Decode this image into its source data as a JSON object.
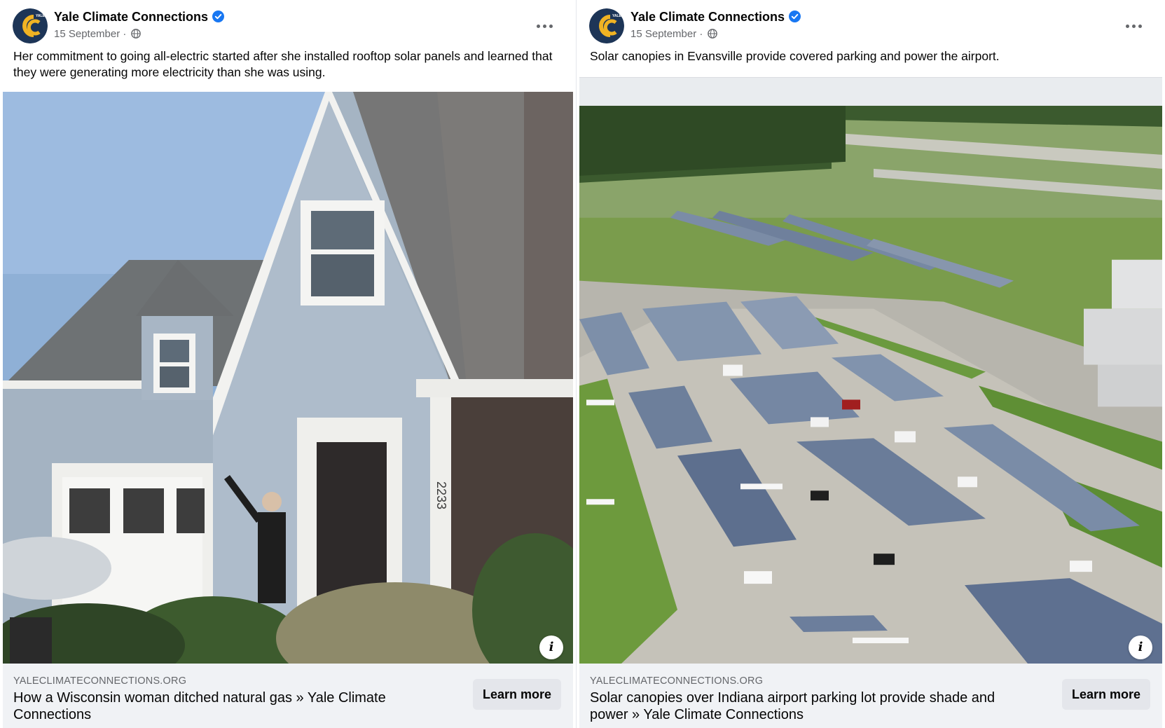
{
  "colors": {
    "verified_blue": "#1877f2",
    "brand_gold": "#f0b323",
    "brand_navy": "#1d3557"
  },
  "posts": [
    {
      "author": "Yale Climate Connections",
      "avatar_text": "YALE",
      "date": "15 September",
      "separator": "·",
      "caption": "Her commitment to going all-electric started after she installed rooftop solar panels and learned that they were generating more electricity than she was using.",
      "image_alt": "Woman waving in front of a gray-blue two-story house",
      "house_number": "2233",
      "link": {
        "domain": "YALECLIMATECONNECTIONS.ORG",
        "headline": "How a Wisconsin woman ditched natural gas » Yale Climate Connections",
        "cta": "Learn more"
      },
      "info_icon": "i"
    },
    {
      "author": "Yale Climate Connections",
      "avatar_text": "YALE",
      "date": "15 September",
      "separator": "·",
      "caption": "Solar canopies in Evansville provide covered parking and power the airport.",
      "image_alt": "Aerial view of solar panel canopies over an airport parking lot",
      "link": {
        "domain": "YALECLIMATECONNECTIONS.ORG",
        "headline": "Solar canopies over Indiana airport parking lot provide shade and power » Yale Climate Connections",
        "cta": "Learn more"
      },
      "info_icon": "i"
    }
  ]
}
